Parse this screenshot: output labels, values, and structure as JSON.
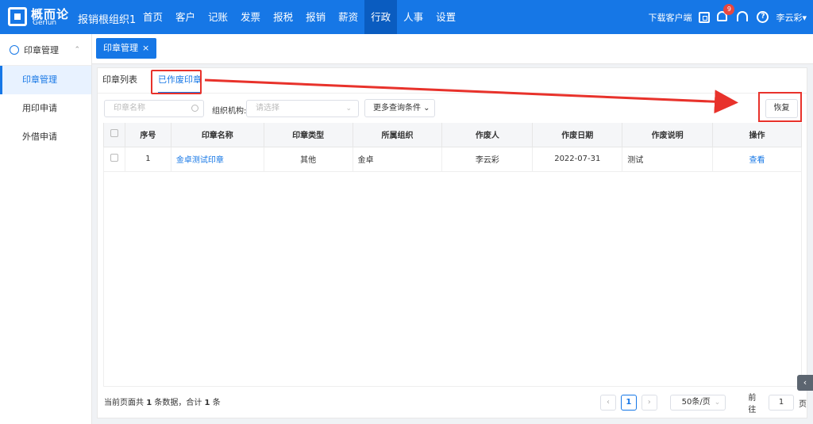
{
  "header": {
    "logo_cn": "概而论",
    "logo_en": "Gerlun",
    "org_name": "报销根组织1",
    "nav": [
      "首页",
      "客户",
      "记账",
      "发票",
      "报税",
      "报销",
      "薪资",
      "行政",
      "人事",
      "设置"
    ],
    "active_nav": "行政",
    "download_label": "下载客户端",
    "notification_count": "9",
    "user_name": "李云彩▾"
  },
  "sidebar": {
    "section_title": "印章管理",
    "items": [
      "印章管理",
      "用印申请",
      "外借申请"
    ],
    "active_item": "印章管理"
  },
  "page_tab": {
    "label": "印章管理",
    "close": "×"
  },
  "subtabs": [
    "印章列表",
    "已作废印章"
  ],
  "active_subtab": "已作废印章",
  "filters": {
    "seal_name_placeholder": "印章名称",
    "org_label": "组织机构:",
    "org_placeholder": "请选择",
    "more_conditions": "更多查询条件 ⌄",
    "restore_label": "恢复"
  },
  "table": {
    "columns": [
      "序号",
      "印章名称",
      "印章类型",
      "所属组织",
      "作废人",
      "作废日期",
      "作废说明",
      "操作"
    ],
    "rows": [
      {
        "index": "1",
        "name": "金卓测试印章",
        "type": "其他",
        "org": "金卓",
        "voider": "李云彩",
        "date": "2022-07-31",
        "note": "测试",
        "action": "查看"
      }
    ]
  },
  "footer": {
    "prefix": "当前页面共",
    "count": "1",
    "mid": "条数据，合计",
    "total": "1",
    "suffix": "条",
    "page": "1",
    "page_size": "50条/页",
    "goto_label": "前往",
    "goto_value": "1",
    "goto_suffix": "页",
    "prev": "‹",
    "next": "›"
  },
  "colors": {
    "primary": "#1677e6",
    "highlight": "#e8322b"
  }
}
